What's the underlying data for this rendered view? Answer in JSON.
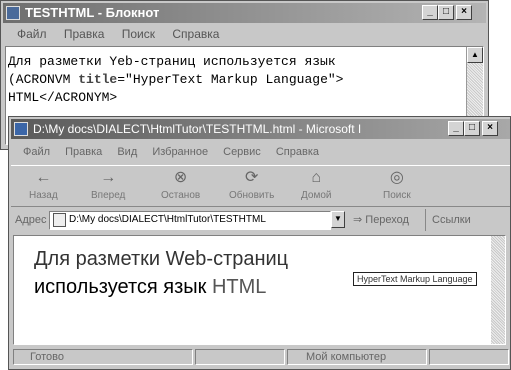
{
  "notepad": {
    "title": "TESTHTML - Блокнот",
    "menu": [
      "Файл",
      "Правка",
      "Поиск",
      "Справка"
    ],
    "lines": {
      "l1": "Для разметки Yeb-страниц используется язык",
      "l2_pre": "(ACRONVM ",
      "l2_attr": "title",
      "l2_post": "=\"HyperText Markup Language\">",
      "l3": "HTML</ACRONYM>"
    }
  },
  "browser": {
    "title": "D:\\My docs\\DIALECT\\HtmlTutor\\TESTHTML.html - Microsoft I",
    "menu": [
      "Файл",
      "Правка",
      "Вид",
      "Избранное",
      "Сервис",
      "Справка"
    ],
    "toolbar": {
      "back": "Назад",
      "forward": "Вперед",
      "stop": "Останов",
      "refresh": "Обновить",
      "home": "Домой",
      "search": "Поиск"
    },
    "address_label": "Адрес",
    "address_value": "D:\\My docs\\DIALECT\\HtmlTutor\\TESTHTML",
    "go_label": "Переход",
    "links_label": "Ссылки",
    "content": {
      "line1": "Для разметки Web-страниц",
      "line2_pre": "используется язык ",
      "line2_abbr": "HTML"
    },
    "tooltip": "HyperText Markup Language",
    "status_ready": "Готово",
    "status_zone": "Мой компьютер"
  }
}
